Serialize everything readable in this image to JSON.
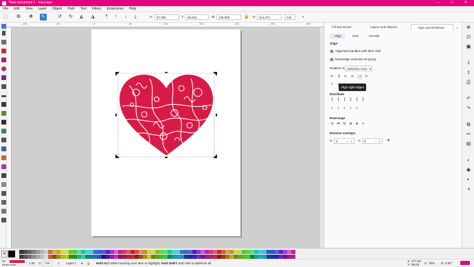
{
  "window": {
    "title": "*New document 1 - Inkscape"
  },
  "menu": [
    "File",
    "Edit",
    "View",
    "Layer",
    "Object",
    "Path",
    "Text",
    "Filters",
    "Extensions",
    "Help"
  ],
  "toolbar": {
    "x_label": "X:",
    "x": "57.055",
    "y_label": "Y:",
    "y": "66.812",
    "w_label": "W:",
    "w": "125.000",
    "h_label": "H:",
    "h": "114.474",
    "unit": "mm"
  },
  "ruler": [
    "-100",
    "-50",
    "0",
    "50",
    "100",
    "150",
    "200",
    "250",
    "300"
  ],
  "tabs": [
    {
      "label": "Fill and Stroke"
    },
    {
      "label": "Layers and Objects"
    },
    {
      "label": "Align and Distribute"
    }
  ],
  "subtabs": [
    {
      "label": "Align"
    },
    {
      "label": "Grid"
    },
    {
      "label": "Circular"
    }
  ],
  "align": {
    "section": "Align",
    "option1": "Alignment handles with third click",
    "option2": "Move/align selection as group",
    "relative_label": "Relative to:",
    "relative_value": "Selection Area",
    "tooltip": "Align right edges",
    "distribute": "Distribute",
    "rearrange": "Rearrange",
    "overlaps": "Remove overlaps",
    "h_label": "H:",
    "h_value": "0",
    "v_label": "V:",
    "v_value": "0"
  },
  "status": {
    "fill_label": "Fill:",
    "stroke_label": "Stroke:",
    "fill_value": "",
    "stroke_value": "Unset",
    "stroke_width": "1.00",
    "opacity_label": "O:",
    "opacity": "100",
    "layer": "Layer 1",
    "message_bold1": "Hold ALT",
    "message_mid": " while hovering over item to highlight, ",
    "message_bold2": "hold SHIFT",
    "message_end": " and click to hide/lock all.",
    "x_label": "X:",
    "x": "277.04",
    "y_label": "Y:",
    "y": "58.03",
    "z_label": "Z:",
    "zoom": "76%",
    "r_label": "R:",
    "rotation": "0.00°"
  },
  "colors": {
    "accent": "#e5007d",
    "heart": "#d81b46",
    "select": "#3a7bd5"
  }
}
